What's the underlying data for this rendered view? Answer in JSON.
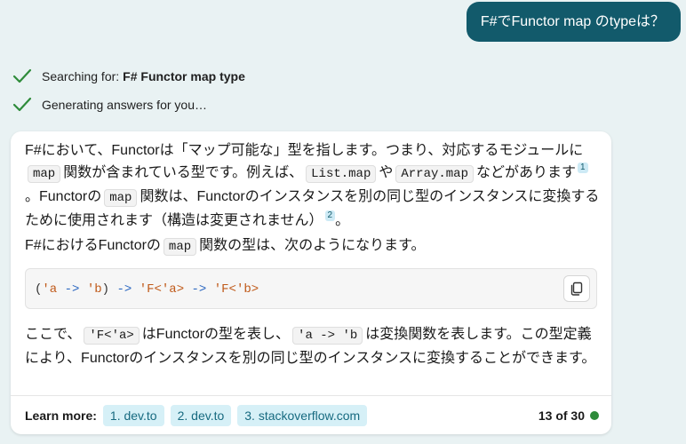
{
  "user_message": "F#でFunctor map のtypeは？",
  "status": {
    "searching_prefix": "Searching for:",
    "searching_query": "F# Functor map type",
    "generating": "Generating answers for you…"
  },
  "answer": {
    "p1": {
      "t1": "F#において、Functorは「マップ可能な」型を指します。つまり、対応するモジュールに",
      "c1": "map",
      "t2": "関数が含まれている型です。例えば、",
      "c2": "List.map",
      "t3": "や",
      "c3": "Array.map",
      "t4": "などがあります",
      "cite1": "1",
      "t5": "。Functorの",
      "c4": "map",
      "t6": "関数は、Functorのインスタンスを別の同じ型のインスタンスに変換するために使用されます（構造は変更されません）",
      "cite2": "2",
      "t7": "。"
    },
    "p2": {
      "t1": "F#におけるFunctorの",
      "c1": "map",
      "t2": "関数の型は、次のようになります。"
    },
    "code": {
      "tok1": "(",
      "tok2": "'a",
      "tok3": "->",
      "tok4": "'b",
      "tok5": ")",
      "tok6": "->",
      "tok7": "'F<'a>",
      "tok8": "->",
      "tok9": "'F<'b>"
    },
    "p3": {
      "t1": "ここで、",
      "c1": "'F<'a>",
      "t2": "はFunctorの型を表し、",
      "c2": "'a -> 'b",
      "t3": "は変換関数を表します。この型定義により、Functorのインスタンスを別の同じ型のインスタンスに変換することができます。"
    }
  },
  "footer": {
    "learn_more": "Learn more:",
    "links": [
      "1. dev.to",
      "2. dev.to",
      "3. stackoverflow.com"
    ],
    "count": "13 of 30"
  },
  "colors": {
    "user_bubble": "#125a6b",
    "check": "#2e8b3a",
    "link_bg": "#d6f0f7",
    "status_dot": "#2e8b3a"
  },
  "icons": [
    "check-icon",
    "copy-icon",
    "status-dot"
  ]
}
